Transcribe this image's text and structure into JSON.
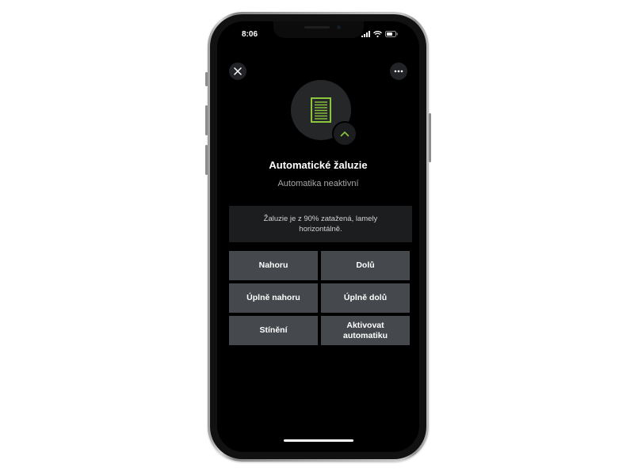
{
  "status_bar": {
    "time": "8:06",
    "icons": [
      "signal-icon",
      "wifi-icon",
      "battery-icon"
    ]
  },
  "header": {
    "close_icon": "close-icon",
    "more_icon": "more-icon"
  },
  "device": {
    "icon": "blinds-icon",
    "badge_icon": "chevron-up-icon",
    "title": "Automatické žaluzie",
    "status": "Automatika neaktivní",
    "info": "Žaluzie je z 90% zatažená, lamely horizontálně."
  },
  "actions": [
    {
      "label": "Nahoru"
    },
    {
      "label": "Dolů"
    },
    {
      "label": "Úplně nahoru"
    },
    {
      "label": "Úplně dolů"
    },
    {
      "label": "Stínění"
    },
    {
      "label": "Aktivovat automatiku"
    }
  ],
  "colors": {
    "accent": "#8cc63f",
    "button_bg": "#45484d",
    "screen_bg": "#000000",
    "info_bg": "#1c1d1f"
  }
}
